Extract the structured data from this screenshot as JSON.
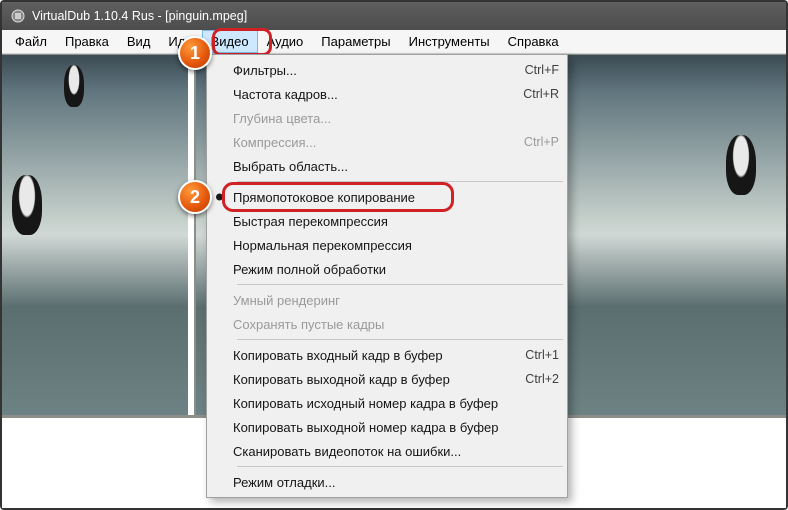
{
  "title": "VirtualDub 1.10.4 Rus - [pinguin.mpeg]",
  "menubar": [
    "Файл",
    "Правка",
    "Вид",
    "Иди",
    "Видео",
    "Аудио",
    "Параметры",
    "Инструменты",
    "Справка"
  ],
  "open_menu_index": 4,
  "callouts": {
    "1": "1",
    "2": "2"
  },
  "dropdown": {
    "groups": [
      [
        {
          "label": "Фильтры...",
          "shortcut": "Ctrl+F",
          "disabled": false
        },
        {
          "label": "Частота кадров...",
          "shortcut": "Ctrl+R",
          "disabled": false
        },
        {
          "label": "Глубина цвета...",
          "shortcut": "",
          "disabled": true
        },
        {
          "label": "Компрессия...",
          "shortcut": "Ctrl+P",
          "disabled": true
        },
        {
          "label": "Выбрать область...",
          "shortcut": "",
          "disabled": false
        }
      ],
      [
        {
          "label": "Прямопотоковое копирование",
          "shortcut": "",
          "disabled": false,
          "checked": true,
          "highlight": true
        },
        {
          "label": "Быстрая перекомпрессия",
          "shortcut": "",
          "disabled": false
        },
        {
          "label": "Нормальная перекомпрессия",
          "shortcut": "",
          "disabled": false
        },
        {
          "label": "Режим полной обработки",
          "shortcut": "",
          "disabled": false
        }
      ],
      [
        {
          "label": "Умный рендеринг",
          "shortcut": "",
          "disabled": true
        },
        {
          "label": "Сохранять пустые кадры",
          "shortcut": "",
          "disabled": true
        }
      ],
      [
        {
          "label": "Копировать входный кадр в буфер",
          "shortcut": "Ctrl+1",
          "disabled": false
        },
        {
          "label": "Копировать выходной кадр в буфер",
          "shortcut": "Ctrl+2",
          "disabled": false
        },
        {
          "label": "Копировать исходный номер кадра в буфер",
          "shortcut": "",
          "disabled": false
        },
        {
          "label": "Копировать выходной номер кадра в буфер",
          "shortcut": "",
          "disabled": false
        },
        {
          "label": "Сканировать видеопоток на ошибки...",
          "shortcut": "",
          "disabled": false
        }
      ],
      [
        {
          "label": "Режим отладки...",
          "shortcut": "",
          "disabled": false
        }
      ]
    ]
  }
}
